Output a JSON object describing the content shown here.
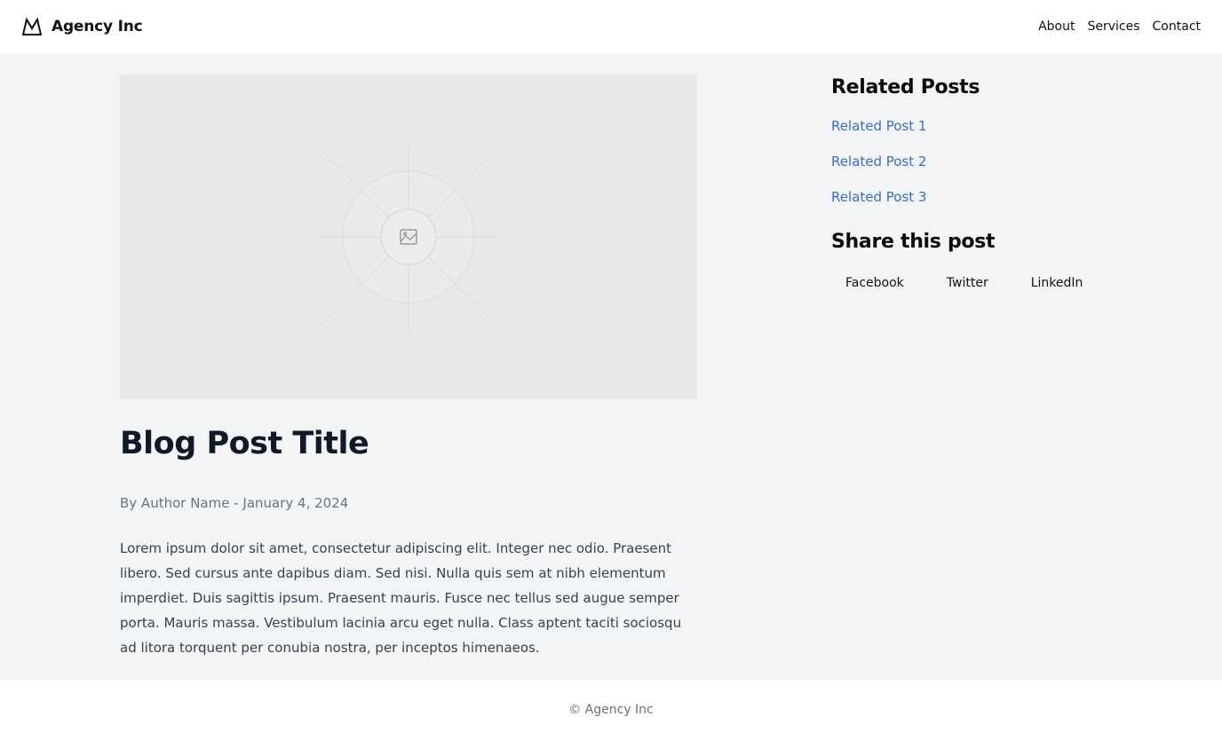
{
  "header": {
    "brand_name": "Agency Inc",
    "logo_icon": "mountain-icon",
    "nav": [
      {
        "label": "About"
      },
      {
        "label": "Services"
      },
      {
        "label": "Contact"
      }
    ]
  },
  "hero": {
    "image_icon": "image-placeholder-icon"
  },
  "post": {
    "title": "Blog Post Title",
    "meta": "By Author Name - January 4, 2024",
    "body": "Lorem ipsum dolor sit amet, consectetur adipiscing elit. Integer nec odio. Praesent libero. Sed cursus ante dapibus diam. Sed nisi. Nulla quis sem at nibh elementum imperdiet. Duis sagittis ipsum. Praesent mauris. Fusce nec tellus sed augue semper porta. Mauris massa. Vestibulum lacinia arcu eget nulla. Class aptent taciti sociosqu ad litora torquent per conubia nostra, per inceptos himenaeos."
  },
  "sidebar": {
    "related_heading": "Related Posts",
    "related_posts": [
      {
        "label": "Related Post 1"
      },
      {
        "label": "Related Post 2"
      },
      {
        "label": "Related Post 3"
      }
    ],
    "share_heading": "Share this post",
    "share_buttons": [
      {
        "label": "Facebook"
      },
      {
        "label": "Twitter"
      },
      {
        "label": "LinkedIn"
      }
    ]
  },
  "footer": {
    "copyright": "© Agency Inc"
  },
  "colors": {
    "page_bg": "#f2f4f6",
    "link": "#3b6fb8",
    "muted_text": "#6b7280"
  }
}
